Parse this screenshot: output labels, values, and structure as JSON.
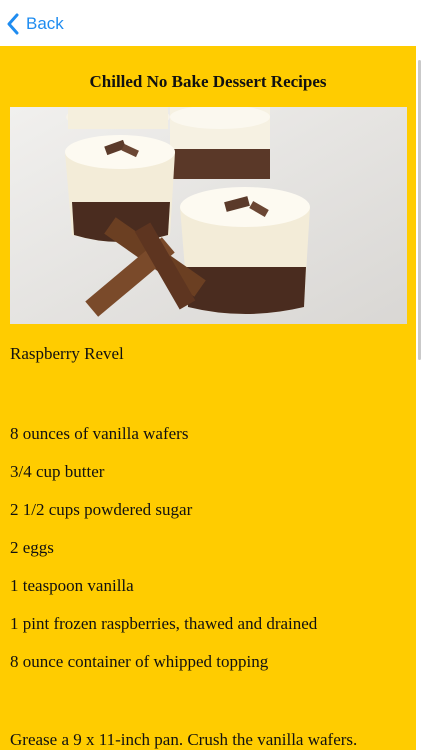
{
  "nav": {
    "back_label": "Back"
  },
  "page": {
    "title": "Chilled No Bake Dessert Recipes"
  },
  "recipe": {
    "name": "Raspberry Revel",
    "ingredients": [
      "8 ounces of vanilla wafers",
      "3/4 cup butter",
      "2 1/2 cups powdered sugar",
      "2 eggs",
      "1 teaspoon vanilla",
      "1 pint frozen raspberries, thawed and drained",
      "8 ounce container of whipped topping"
    ],
    "instructions_start": "Grease a 9 x 11-inch pan. Crush the vanilla wafers."
  },
  "colors": {
    "background": "#ffcc00",
    "accent": "#1f8cf0"
  }
}
